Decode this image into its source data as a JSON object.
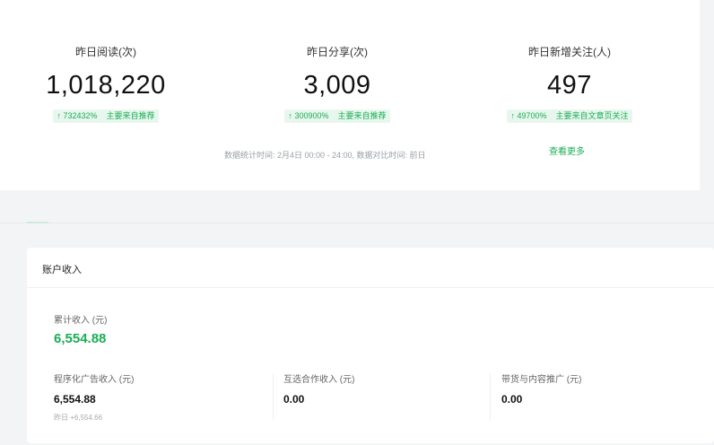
{
  "stats": [
    {
      "label": "昨日阅读(次)",
      "value": "1,018,220",
      "trend_pct": "↑ 732432%",
      "trend_source": "主要来自推荐"
    },
    {
      "label": "昨日分享(次)",
      "value": "3,009",
      "trend_pct": "↑ 300900%",
      "trend_source": "主要来自推荐"
    },
    {
      "label": "昨日新增关注(人)",
      "value": "497",
      "trend_pct": "↑ 49700%",
      "trend_source": "主要来自文章页关注"
    }
  ],
  "meta_note": "数据统计时间: 2月4日 00:00 - 24:00, 数据对比时间: 前日",
  "view_more": "查看更多",
  "income": {
    "title": "账户收入",
    "total_label": "累计收入 (元)",
    "total_value": "6,554.88",
    "items": [
      {
        "label": "程序化广告收入 (元)",
        "value": "6,554.88",
        "yesterday": "昨日 +6,554.66"
      },
      {
        "label": "互选合作收入 (元)",
        "value": "0.00"
      },
      {
        "label": "带货与内容推广 (元)",
        "value": "0.00"
      }
    ]
  },
  "colors": {
    "accent": "#1aad55",
    "trend_bg": "#e8f7ee",
    "page_bg": "#f3f4f5"
  }
}
